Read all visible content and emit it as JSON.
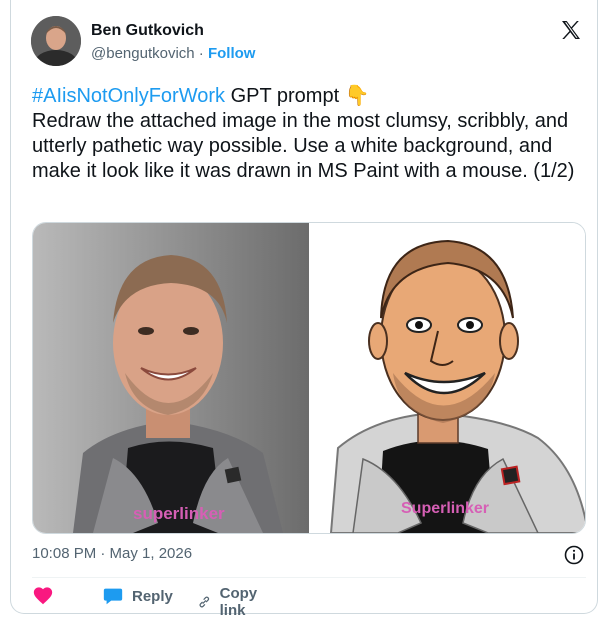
{
  "author": {
    "name": "Ben Gutkovich",
    "handle": "@bengutkovich",
    "separator": "·",
    "follow_label": "Follow"
  },
  "tweet": {
    "hashtag": "#AIisNotOnlyForWork",
    "text_after_hashtag": " GPT prompt ",
    "emoji": "👇",
    "body": "Redraw the attached image in the most clumsy, scribbly, and utterly pathetic way possible. Use a white background, and make it look like it was drawn in MS Paint with a mouse. (1/2)"
  },
  "media": {
    "left_shirt_text": "superlinker",
    "right_shirt_text": "Superlinker"
  },
  "meta": {
    "timestamp": "10:08 PM · May 1, 2026"
  },
  "actions": {
    "reply_label": "Reply",
    "copy_link_label": "Copy link"
  },
  "colors": {
    "accent": "#1d9bf0",
    "like": "#f91880",
    "text": "#0f1419",
    "muted": "#536471"
  },
  "icons": [
    "x-logo-icon",
    "emoji-pointing-down",
    "info-icon",
    "heart-icon",
    "reply-bubble-icon",
    "link-icon"
  ]
}
